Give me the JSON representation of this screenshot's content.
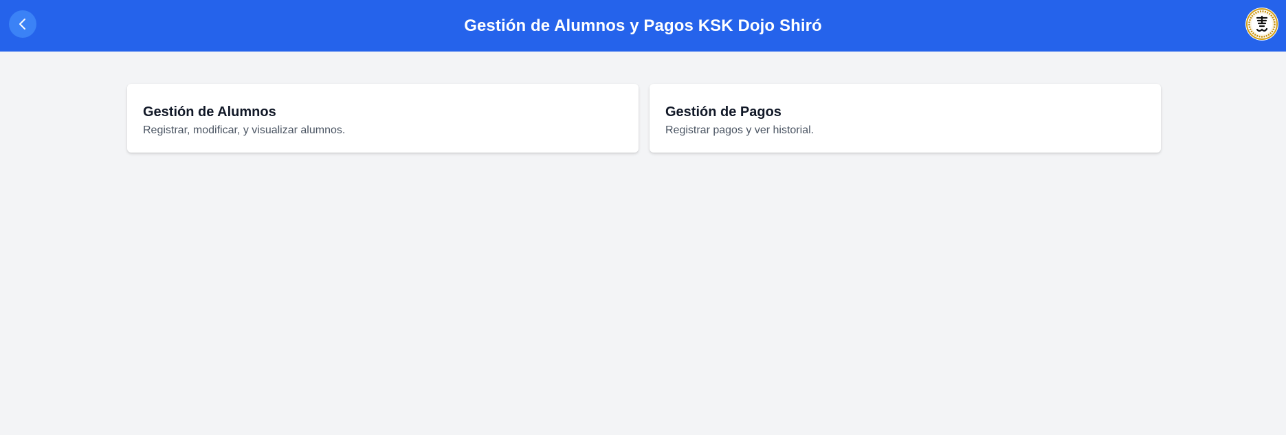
{
  "header": {
    "title": "Gestión de Alumnos y Pagos KSK Dojo Shiró",
    "back_icon": "chevron-left-icon",
    "logo_icon": "dojo-logo-icon",
    "background_color": "#2563eb",
    "back_button_color": "#3b82f6"
  },
  "cards": [
    {
      "title": "Gestión de Alumnos",
      "description": "Registrar, modificar, y visualizar alumnos."
    },
    {
      "title": "Gestión de Pagos",
      "description": "Registrar pagos y ver historial."
    }
  ]
}
